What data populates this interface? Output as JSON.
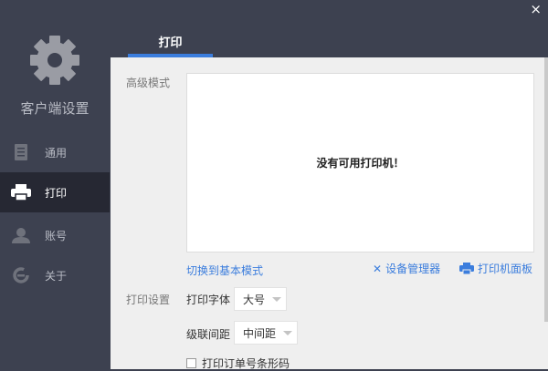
{
  "window": {
    "close": "×"
  },
  "sidebar": {
    "title": "客户端设置",
    "items": [
      {
        "label": "通用"
      },
      {
        "label": "打印",
        "active": true
      },
      {
        "label": "账号"
      },
      {
        "label": "关于"
      }
    ]
  },
  "tab": {
    "label": "打印"
  },
  "advanced": {
    "label": "高级模式",
    "empty_message": "没有可用打印机！",
    "switch_link": "切换到基本模式",
    "device_manager": "设备管理器",
    "printer_panel": "打印机面板"
  },
  "settings": {
    "label": "打印设置",
    "font_label": "打印字体",
    "font_value": "大号",
    "spacing_label": "级联间距",
    "spacing_value": "中间距",
    "barcode_label": "打印订单号条形码",
    "barcode_checked": false
  },
  "colors": {
    "accent": "#3b7ddd",
    "sidebar": "#3d4150",
    "active": "#262833"
  }
}
